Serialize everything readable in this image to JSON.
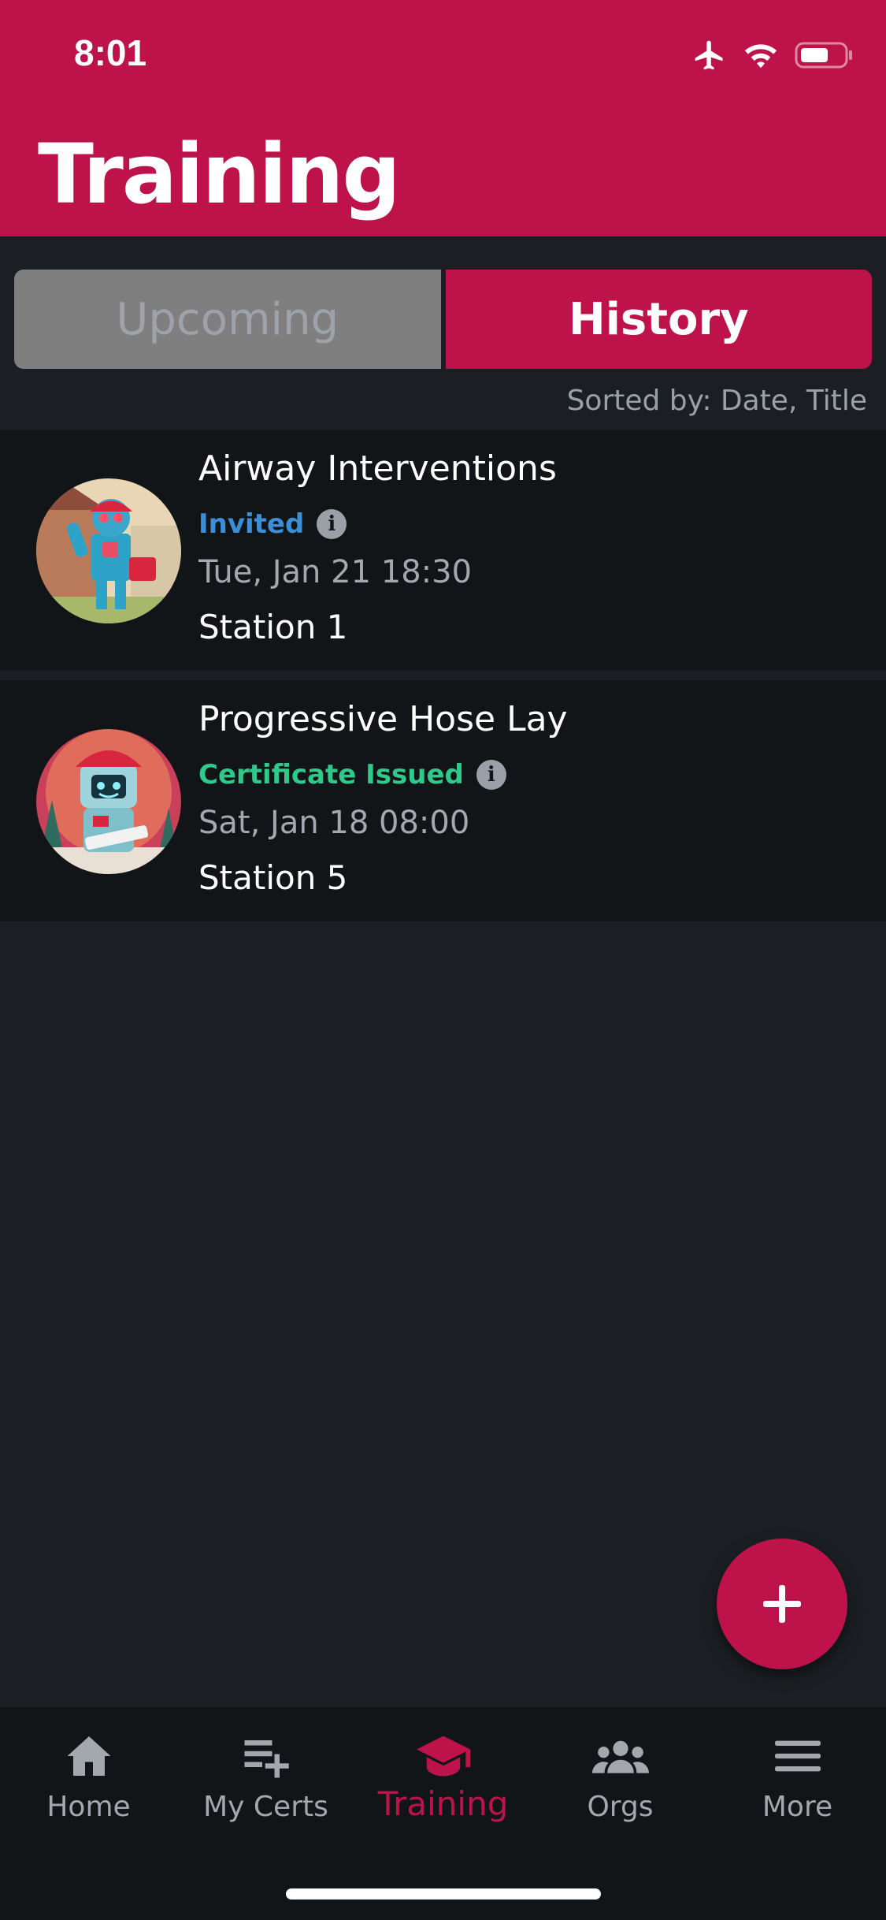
{
  "status_bar": {
    "time": "8:01"
  },
  "header": {
    "title": "Training"
  },
  "segments": {
    "upcoming": "Upcoming",
    "history": "History",
    "selected": "History"
  },
  "sort_label": "Sorted by: Date, Title",
  "items": [
    {
      "title": "Airway Interventions",
      "status": "Invited",
      "status_color": "#3b8fd9",
      "date": "Tue, Jan 21 18:30",
      "location": "Station 1",
      "avatar_icon": "robot-paramedic-avatar"
    },
    {
      "title": "Progressive Hose Lay",
      "status": "Certificate Issued",
      "status_color": "#2fc98a",
      "date": "Sat, Jan 18 08:00",
      "location": "Station 5",
      "avatar_icon": "robot-firefighter-avatar"
    }
  ],
  "fab": {
    "icon": "plus-icon"
  },
  "tabbar": {
    "tabs": [
      {
        "label": "Home",
        "icon": "home-icon"
      },
      {
        "label": "My Certs",
        "icon": "playlist-add-icon"
      },
      {
        "label": "Training",
        "icon": "graduation-cap-icon",
        "active": true
      },
      {
        "label": "Orgs",
        "icon": "group-icon"
      },
      {
        "label": "More",
        "icon": "menu-icon"
      }
    ]
  },
  "colors": {
    "accent": "#bd124a",
    "background": "#1b1f23",
    "card": "#121518"
  }
}
